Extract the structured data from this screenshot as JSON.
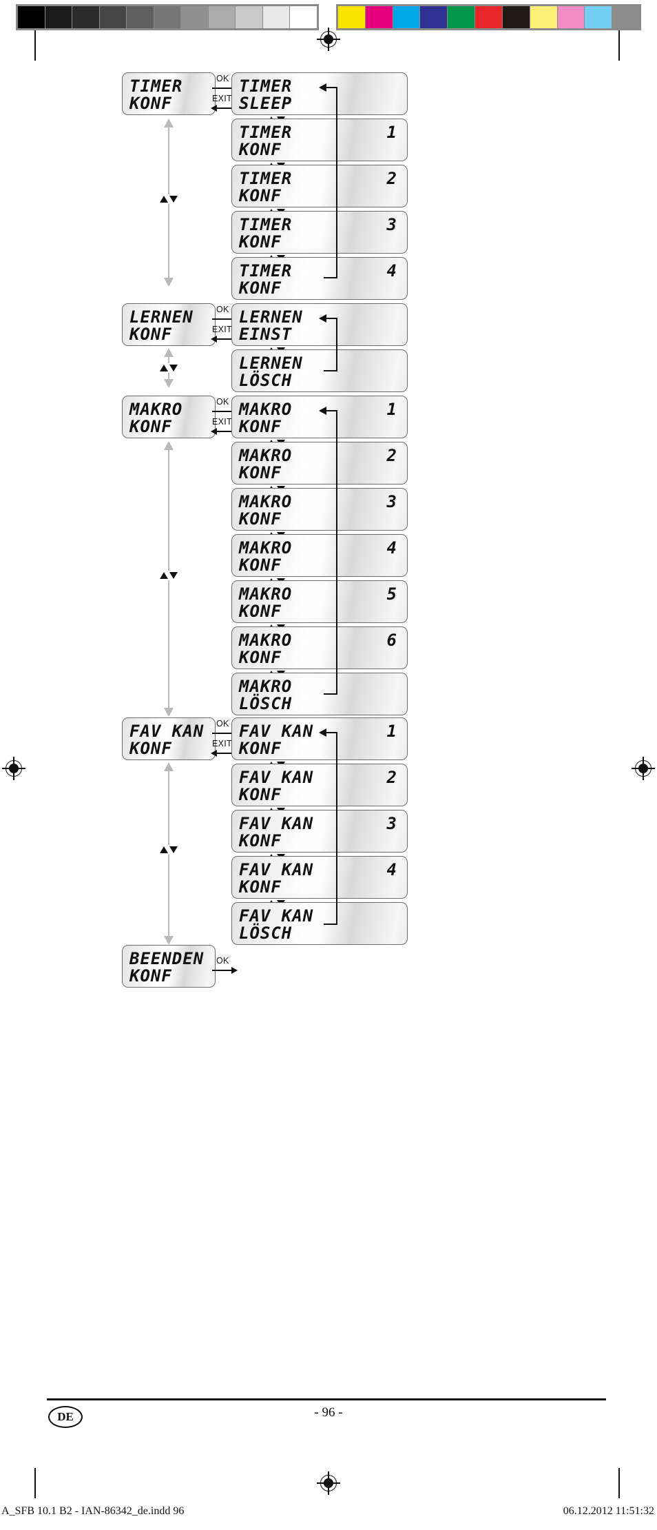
{
  "document": {
    "page_number": "- 96 -",
    "language_badge": "DE",
    "imprint_left": "A_SFB 10.1 B2 - IAN-86342_de.indd   96",
    "imprint_right": "06.12.2012   11:51:32"
  },
  "calibration": {
    "grayscale_swatches": [
      "#000000",
      "#1a1a1a",
      "#2b2b2b",
      "#474747",
      "#5e5e5e",
      "#767676",
      "#909090",
      "#ababab",
      "#c9c9c9",
      "#e9e9e9",
      "#ffffff"
    ],
    "color_swatches": [
      "#fbe400",
      "#e6007e",
      "#00a7e7",
      "#2e3192",
      "#00974b",
      "#e8262a",
      "#1f1a17",
      "#fbef7a",
      "#f28cc4",
      "#73d0f4",
      "#8d8d8d"
    ]
  },
  "transitions": {
    "ok_label": "OK",
    "exit_label": "EXIT"
  },
  "menu": {
    "sections": [
      {
        "id": "timer",
        "root": {
          "line1": "TIMER",
          "line2": "KONF"
        },
        "items": [
          {
            "line1": "TIMER",
            "line2": "SLEEP",
            "num": ""
          },
          {
            "line1": "TIMER",
            "line2": "KONF",
            "num": "1"
          },
          {
            "line1": "TIMER",
            "line2": "KONF",
            "num": "2"
          },
          {
            "line1": "TIMER",
            "line2": "KONF",
            "num": "3"
          },
          {
            "line1": "TIMER",
            "line2": "KONF",
            "num": "4"
          }
        ]
      },
      {
        "id": "lernen",
        "root": {
          "line1": "LERNEN",
          "line2": "KONF"
        },
        "items": [
          {
            "line1": "LERNEN",
            "line2": "EINST",
            "num": ""
          },
          {
            "line1": "LERNEN",
            "line2": "LÖSCH",
            "num": ""
          }
        ]
      },
      {
        "id": "makro",
        "root": {
          "line1": "MAKRO",
          "line2": "KONF"
        },
        "items": [
          {
            "line1": "MAKRO",
            "line2": "KONF",
            "num": "1"
          },
          {
            "line1": "MAKRO",
            "line2": "KONF",
            "num": "2"
          },
          {
            "line1": "MAKRO",
            "line2": "KONF",
            "num": "3"
          },
          {
            "line1": "MAKRO",
            "line2": "KONF",
            "num": "4"
          },
          {
            "line1": "MAKRO",
            "line2": "KONF",
            "num": "5"
          },
          {
            "line1": "MAKRO",
            "line2": "KONF",
            "num": "6"
          },
          {
            "line1": "MAKRO",
            "line2": "LÖSCH",
            "num": ""
          }
        ]
      },
      {
        "id": "favkan",
        "root": {
          "line1": "FAV KAN",
          "line2": "KONF"
        },
        "items": [
          {
            "line1": "FAV KAN",
            "line2": "KONF",
            "num": "1"
          },
          {
            "line1": "FAV KAN",
            "line2": "KONF",
            "num": "2"
          },
          {
            "line1": "FAV KAN",
            "line2": "KONF",
            "num": "3"
          },
          {
            "line1": "FAV KAN",
            "line2": "KONF",
            "num": "4"
          },
          {
            "line1": "FAV KAN",
            "line2": "LÖSCH",
            "num": ""
          }
        ]
      },
      {
        "id": "beenden",
        "root": {
          "line1": "BEENDEN",
          "line2": "KONF"
        },
        "items": []
      }
    ]
  }
}
